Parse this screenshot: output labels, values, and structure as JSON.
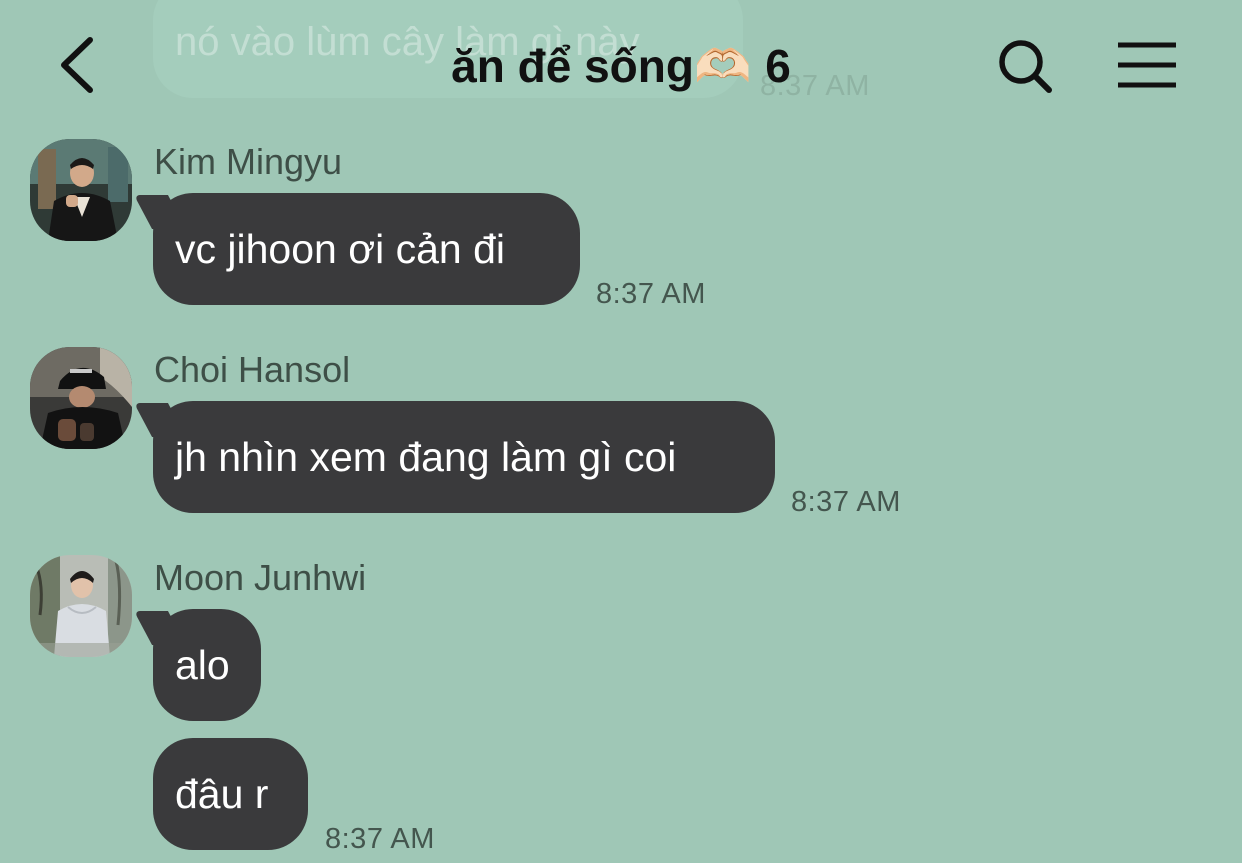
{
  "colors": {
    "background": "#9fc7b6",
    "bubble": "#3a3a3c",
    "bubble_text": "#ffffff",
    "title_text": "#111111",
    "icon": "#111111",
    "sender_name": "#3e4f47",
    "timestamp": "#44564e",
    "faded_bubble": "#a4cdbc",
    "faded_time": "#8fb3a3"
  },
  "header": {
    "back_icon": "chevron-left-icon",
    "title": "ăn để sống🫶🏻",
    "member_count": "6",
    "search_icon": "search-icon",
    "menu_icon": "hamburger-menu-icon"
  },
  "previous_message": {
    "text": "nó vào lùm cây làm gì này",
    "time": "8:37 AM"
  },
  "messages": [
    {
      "sender": "Kim Mingyu",
      "avatar": "avatar-kim-mingyu",
      "bubbles": [
        {
          "text": "vc jihoon ơi cản đi"
        }
      ],
      "time": "8:37 AM"
    },
    {
      "sender": "Choi Hansol",
      "avatar": "avatar-choi-hansol",
      "bubbles": [
        {
          "text": "jh nhìn xem đang làm gì coi"
        }
      ],
      "time": "8:37 AM"
    },
    {
      "sender": "Moon Junhwi",
      "avatar": "avatar-moon-junhwi",
      "bubbles": [
        {
          "text": "alo"
        },
        {
          "text": "đâu r"
        }
      ],
      "time": "8:37 AM"
    }
  ]
}
